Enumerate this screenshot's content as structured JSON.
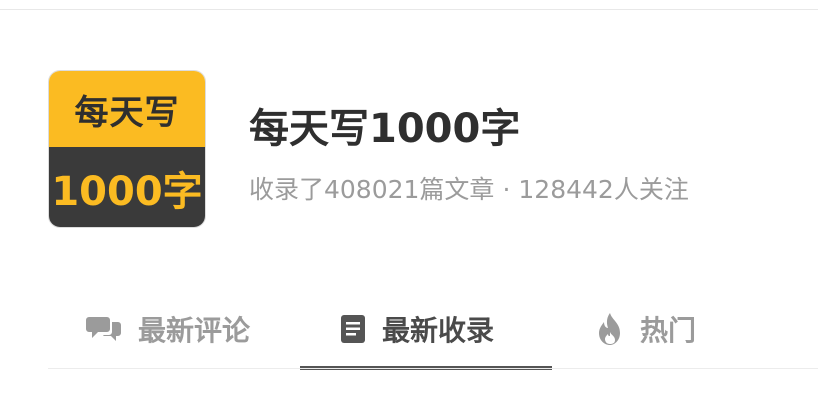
{
  "collection": {
    "logo": {
      "top_text": "每天写",
      "bottom_text": "1000字",
      "top_color": "#fbbb22",
      "bottom_color": "#3a3a3a"
    },
    "title": "每天写1000字",
    "meta": {
      "articles": "收录了408021篇文章",
      "separator": "·",
      "followers": "128442人关注"
    }
  },
  "tabs": [
    {
      "label": "最新评论",
      "icon": "comments-icon",
      "active": false
    },
    {
      "label": "最新收录",
      "icon": "document-icon",
      "active": true
    },
    {
      "label": "热门",
      "icon": "fire-icon",
      "active": false
    }
  ]
}
